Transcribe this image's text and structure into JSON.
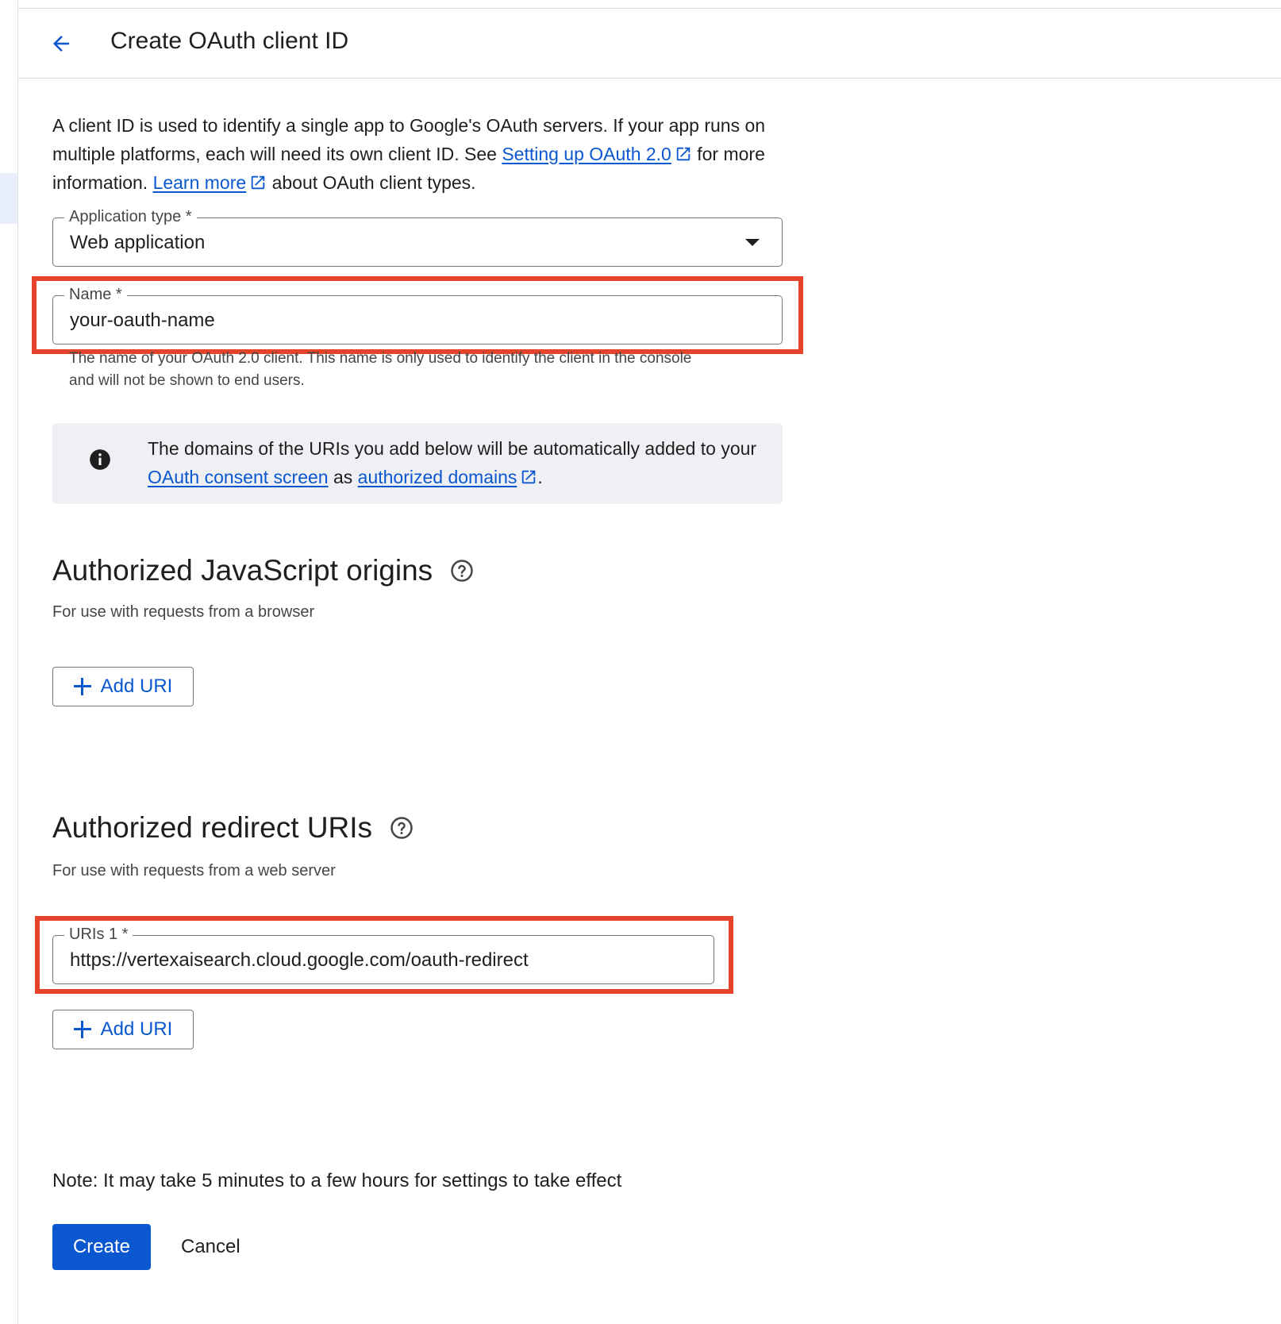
{
  "header": {
    "title": "Create OAuth client ID",
    "back_icon": "arrow-back-icon"
  },
  "intro": {
    "text_1": "A client ID is used to identify a single app to Google's OAuth servers. If your app runs on multiple platforms, each will need its own client ID. See ",
    "link_setup": "Setting up OAuth 2.0",
    "text_2": " for more information. ",
    "link_learn_more": "Learn more",
    "text_3": " about OAuth client types."
  },
  "application_type": {
    "label": "Application type *",
    "value": "Web application"
  },
  "name_field": {
    "label": "Name *",
    "value": "your-oauth-name",
    "helper": "The name of your OAuth 2.0 client. This name is only used to identify the client in the console and will not be shown to end users."
  },
  "info_banner": {
    "icon": "info-icon",
    "text_1": "The domains of the URIs you add below will be automatically added to your ",
    "link_consent": "OAuth consent screen",
    "text_2": " as ",
    "link_domains": "authorized domains",
    "text_3": "."
  },
  "js_origins": {
    "title": "Authorized JavaScript origins",
    "subtitle": "For use with requests from a browser",
    "add_label": "Add URI"
  },
  "redirect_uris": {
    "title": "Authorized redirect URIs",
    "subtitle": "For use with requests from a web server",
    "uri_label": "URIs 1 *",
    "uri_value": "https://vertexaisearch.cloud.google.com/oauth-redirect",
    "add_label": "Add URI"
  },
  "footer": {
    "note": "Note: It may take 5 minutes to a few hours for settings to take effect",
    "create_label": "Create",
    "cancel_label": "Cancel"
  },
  "colors": {
    "accent": "#0b57d0",
    "highlight_border": "#e5432a",
    "info_bg": "#eef0f4"
  }
}
